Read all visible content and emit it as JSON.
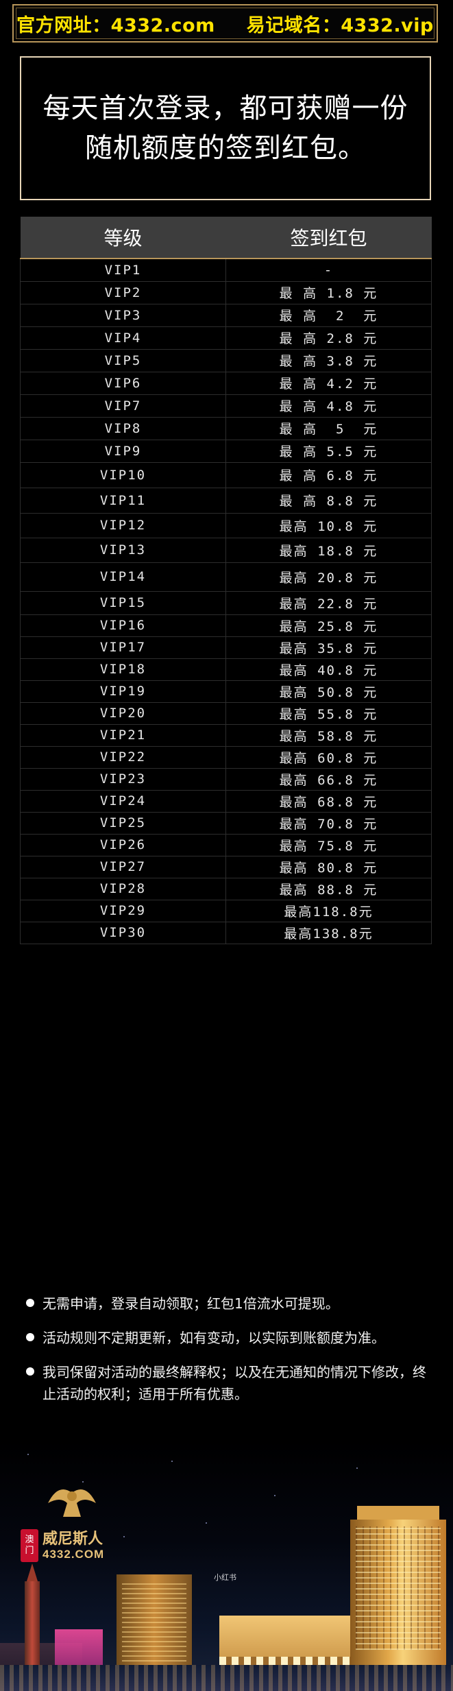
{
  "banner": {
    "official_url": "官方网址：4332.com",
    "easy_domain": "易记域名：4332.vip"
  },
  "notice": {
    "line1": "每天首次登录，都可获赠一份",
    "line2": "随机额度的签到红包。"
  },
  "table": {
    "header_level": "等级",
    "header_bonus": "签到红包",
    "rows": [
      {
        "level": "VIP1",
        "bonus": "-"
      },
      {
        "level": "VIP2",
        "bonus": "最 高 1.8 元"
      },
      {
        "level": "VIP3",
        "bonus": "最 高  2  元"
      },
      {
        "level": "VIP4",
        "bonus": "最 高 2.8 元"
      },
      {
        "level": "VIP5",
        "bonus": "最 高 3.8 元"
      },
      {
        "level": "VIP6",
        "bonus": "最 高 4.2 元"
      },
      {
        "level": "VIP7",
        "bonus": "最 高 4.8 元"
      },
      {
        "level": "VIP8",
        "bonus": "最 高  5  元"
      },
      {
        "level": "VIP9",
        "bonus": "最 高 5.5 元"
      },
      {
        "level": "VIP10",
        "bonus": "最 高 6.8 元"
      },
      {
        "level": "VIP11",
        "bonus": "最 高 8.8 元"
      },
      {
        "level": "VIP12",
        "bonus": "最高 10.8 元"
      },
      {
        "level": "VIP13",
        "bonus": "最高 18.8 元"
      },
      {
        "level": "VIP14",
        "bonus": "最高 20.8 元"
      },
      {
        "level": "VIP15",
        "bonus": "最高 22.8 元"
      },
      {
        "level": "VIP16",
        "bonus": "最高 25.8 元"
      },
      {
        "level": "VIP17",
        "bonus": "最高 35.8 元"
      },
      {
        "level": "VIP18",
        "bonus": "最高 40.8 元"
      },
      {
        "level": "VIP19",
        "bonus": "最高 50.8 元"
      },
      {
        "level": "VIP20",
        "bonus": "最高 55.8 元"
      },
      {
        "level": "VIP21",
        "bonus": "最高 58.8 元"
      },
      {
        "level": "VIP22",
        "bonus": "最高 60.8 元"
      },
      {
        "level": "VIP23",
        "bonus": "最高 66.8 元"
      },
      {
        "level": "VIP24",
        "bonus": "最高 68.8 元"
      },
      {
        "level": "VIP25",
        "bonus": "最高 70.8 元"
      },
      {
        "level": "VIP26",
        "bonus": "最高 75.8 元"
      },
      {
        "level": "VIP27",
        "bonus": "最高 80.8 元"
      },
      {
        "level": "VIP28",
        "bonus": "最高 88.8 元"
      },
      {
        "level": "VIP29",
        "bonus": "最高118.8元"
      },
      {
        "level": "VIP30",
        "bonus": "最高138.8元"
      }
    ]
  },
  "notes": [
    "无需申请，登录自动领取；红包1倍流水可提现。",
    "活动规则不定期更新，如有变动，以实际到账额度为准。",
    "我司保留对活动的最终解释权；以及在无通知的情况下修改，终止活动的权利；适用于所有优惠。"
  ],
  "footer": {
    "seal_text": "澳门",
    "brand_cn": "威尼斯人",
    "brand_en": "4332.COM",
    "watermark": "小红书"
  },
  "colors": {
    "banner_text": "#ffe300",
    "gold_border": "#b8965a",
    "header_bg": "#3d3d3d"
  }
}
